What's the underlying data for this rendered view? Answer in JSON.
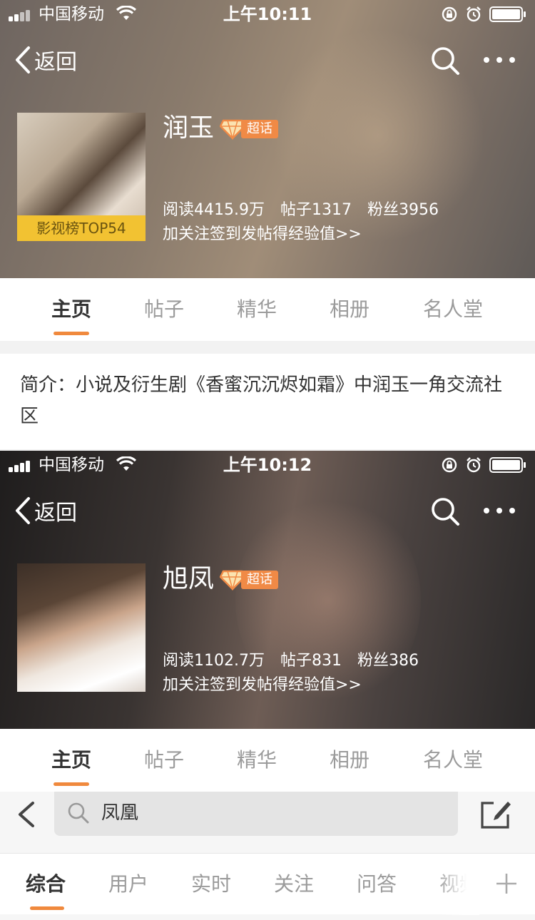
{
  "screen1": {
    "status": {
      "carrier": "中国移动",
      "time": "上午10:11"
    },
    "nav": {
      "back_label": "返回"
    },
    "profile": {
      "name": "润玉",
      "chaohua_tag": "超话",
      "avatar_badge": "影视榜TOP54",
      "stats": {
        "reads": "阅读4415.9万",
        "posts": "帖子1317",
        "fans": "粉丝3956"
      },
      "exp_link": "加关注签到发帖得经验值>>"
    },
    "tabs": [
      "主页",
      "帖子",
      "精华",
      "相册",
      "名人堂"
    ],
    "active_tab": "主页",
    "intro": "简介：小说及衍生剧《香蜜沉沉烬如霜》中润玉一角交流社区"
  },
  "screen2": {
    "status": {
      "carrier": "中国移动",
      "time": "上午10:12"
    },
    "nav": {
      "back_label": "返回"
    },
    "profile": {
      "name": "旭凤",
      "chaohua_tag": "超话",
      "stats": {
        "reads": "阅读1102.7万",
        "posts": "帖子831",
        "fans": "粉丝386"
      },
      "exp_link": "加关注签到发帖得经验值>>"
    },
    "tabs": [
      "主页",
      "帖子",
      "精华",
      "相册",
      "名人堂"
    ],
    "active_tab": "主页"
  },
  "screen3": {
    "search": {
      "query": "凤凰"
    },
    "tabs": [
      "综合",
      "用户",
      "实时",
      "关注",
      "问答",
      "视频"
    ],
    "active_tab": "综合"
  },
  "colors": {
    "accent": "#f0893d",
    "badge_yellow": "#f2c232",
    "tag_orange": "#f08a46"
  }
}
